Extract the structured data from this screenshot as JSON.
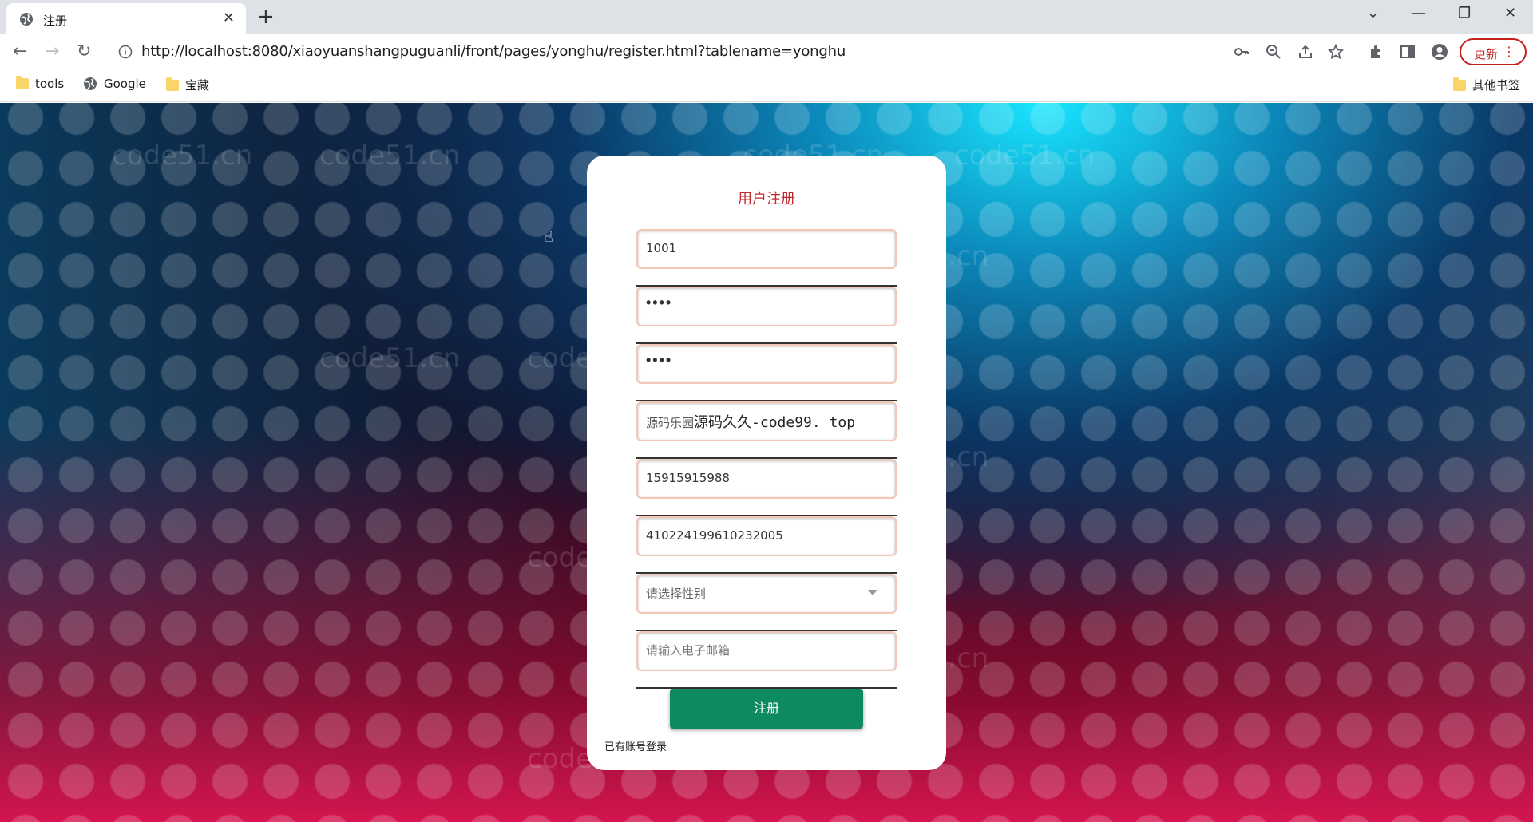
{
  "browser": {
    "tab_title": "注册",
    "new_tab": "+",
    "close_tab": "✕",
    "url": "http://localhost:8080/xiaoyuanshangpuguanli/front/pages/yonghu/register.html?tablename=yonghu",
    "update_label": "更新",
    "bookmarks": [
      "tools",
      "Google",
      "宝藏"
    ],
    "other_bookmarks": "其他书签"
  },
  "watermark": "code51.cn",
  "form": {
    "title": "用户注册",
    "account": "1001",
    "password_mask": "••••",
    "confirm_mask": "••••",
    "name_prefix": "源码乐园",
    "name_main": "源码久久-code99. top",
    "phone": "15915915988",
    "id_card": "410224199610232005",
    "gender_placeholder": "请选择性别",
    "email_placeholder": "请输入电子邮箱",
    "submit_label": "注册",
    "login_link": "已有账号登录"
  }
}
